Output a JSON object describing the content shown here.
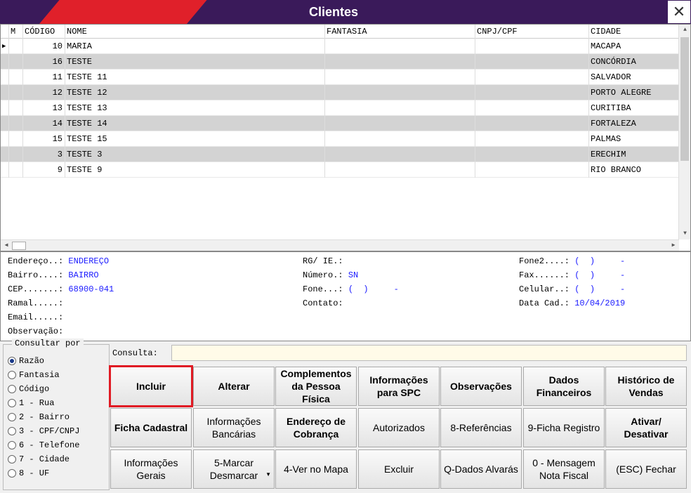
{
  "window": {
    "title": "Clientes"
  },
  "grid": {
    "columns": [
      "M",
      "CÓDIGO",
      "NOME",
      "FANTASIA",
      "CNPJ/CPF",
      "CIDADE"
    ],
    "rows": [
      {
        "codigo": "10",
        "nome": "MARIA",
        "fantasia": "",
        "cnpj": "",
        "cidade": "MACAPA"
      },
      {
        "codigo": "16",
        "nome": "TESTE",
        "fantasia": "",
        "cnpj": "",
        "cidade": "CONCÓRDIA"
      },
      {
        "codigo": "11",
        "nome": "TESTE 11",
        "fantasia": "",
        "cnpj": "",
        "cidade": "SALVADOR"
      },
      {
        "codigo": "12",
        "nome": "TESTE 12",
        "fantasia": "",
        "cnpj": "",
        "cidade": "PORTO ALEGRE"
      },
      {
        "codigo": "13",
        "nome": "TESTE 13",
        "fantasia": "",
        "cnpj": "",
        "cidade": "CURITIBA"
      },
      {
        "codigo": "14",
        "nome": "TESTE 14",
        "fantasia": "",
        "cnpj": "",
        "cidade": "FORTALEZA"
      },
      {
        "codigo": "15",
        "nome": "TESTE 15",
        "fantasia": "",
        "cnpj": "",
        "cidade": "PALMAS"
      },
      {
        "codigo": "3",
        "nome": "TESTE 3",
        "fantasia": "",
        "cnpj": "",
        "cidade": "ERECHIM"
      },
      {
        "codigo": "9",
        "nome": "TESTE 9",
        "fantasia": "",
        "cnpj": "",
        "cidade": "RIO BRANCO"
      }
    ]
  },
  "details": {
    "endereco_lbl": "Endereço..:",
    "endereco": "ENDEREÇO",
    "bairro_lbl": "Bairro....:",
    "bairro": "BAIRRO",
    "cep_lbl": "CEP.......:",
    "cep": "68900-041",
    "ramal_lbl": "Ramal.....:",
    "email_lbl": "Email.....:",
    "obs_lbl": "Observação:",
    "rg_lbl": "RG/ IE.:",
    "numero_lbl": "Número.:",
    "numero": "SN",
    "fone_lbl": "Fone...:",
    "fone": "(  )     -",
    "contato_lbl": "Contato:",
    "fone2_lbl": "Fone2....:",
    "fone2": "(  )     -",
    "fax_lbl": "Fax......:",
    "fax": "(  )     -",
    "celular_lbl": "Celular..:",
    "celular": "(  )     -",
    "datacad_lbl": "Data Cad.:",
    "datacad": "10/04/2019"
  },
  "consultar_por": {
    "legend": "Consultar por",
    "options": [
      "Razão",
      "Fantasia",
      "Código",
      "1 - Rua",
      "2 - Bairro",
      "3 - CPF/CNPJ",
      "6 - Telefone",
      "7 - Cidade",
      "8 - UF"
    ],
    "selected": "Razão"
  },
  "consulta": {
    "label": "Consulta:",
    "value": ""
  },
  "buttons": {
    "incluir": "Incluir",
    "alterar": "Alterar",
    "complementos": "Complementos da Pessoa Física",
    "info_spc": "Informações para SPC",
    "observacoes": "Observações",
    "dados_financeiros": "Dados Financeiros",
    "historico_vendas": "Histórico de Vendas",
    "ficha_cadastral": "Ficha Cadastral",
    "info_bancarias": "Informações Bancárias",
    "endereco_cobranca": "Endereço de Cobrança",
    "autorizados": "Autorizados",
    "referencias": "8-Referências",
    "ficha_registro": "9-Ficha Registro",
    "ativar_desativar": "Ativar/ Desativar",
    "info_gerais": "Informações Gerais",
    "marcar_desmarcar": "5-Marcar Desmarcar",
    "ver_mapa": "4-Ver no Mapa",
    "excluir": "Excluir",
    "dados_alvaras": "Q-Dados Alvarás",
    "mensagem_nf": "0 - Mensagem Nota Fiscal",
    "fechar": "(ESC) Fechar"
  },
  "colors": {
    "title_bg": "#3a1a5a",
    "title_accent": "#e0202a",
    "selection_outline": "#e01b24",
    "value_text": "#1a1aff"
  }
}
